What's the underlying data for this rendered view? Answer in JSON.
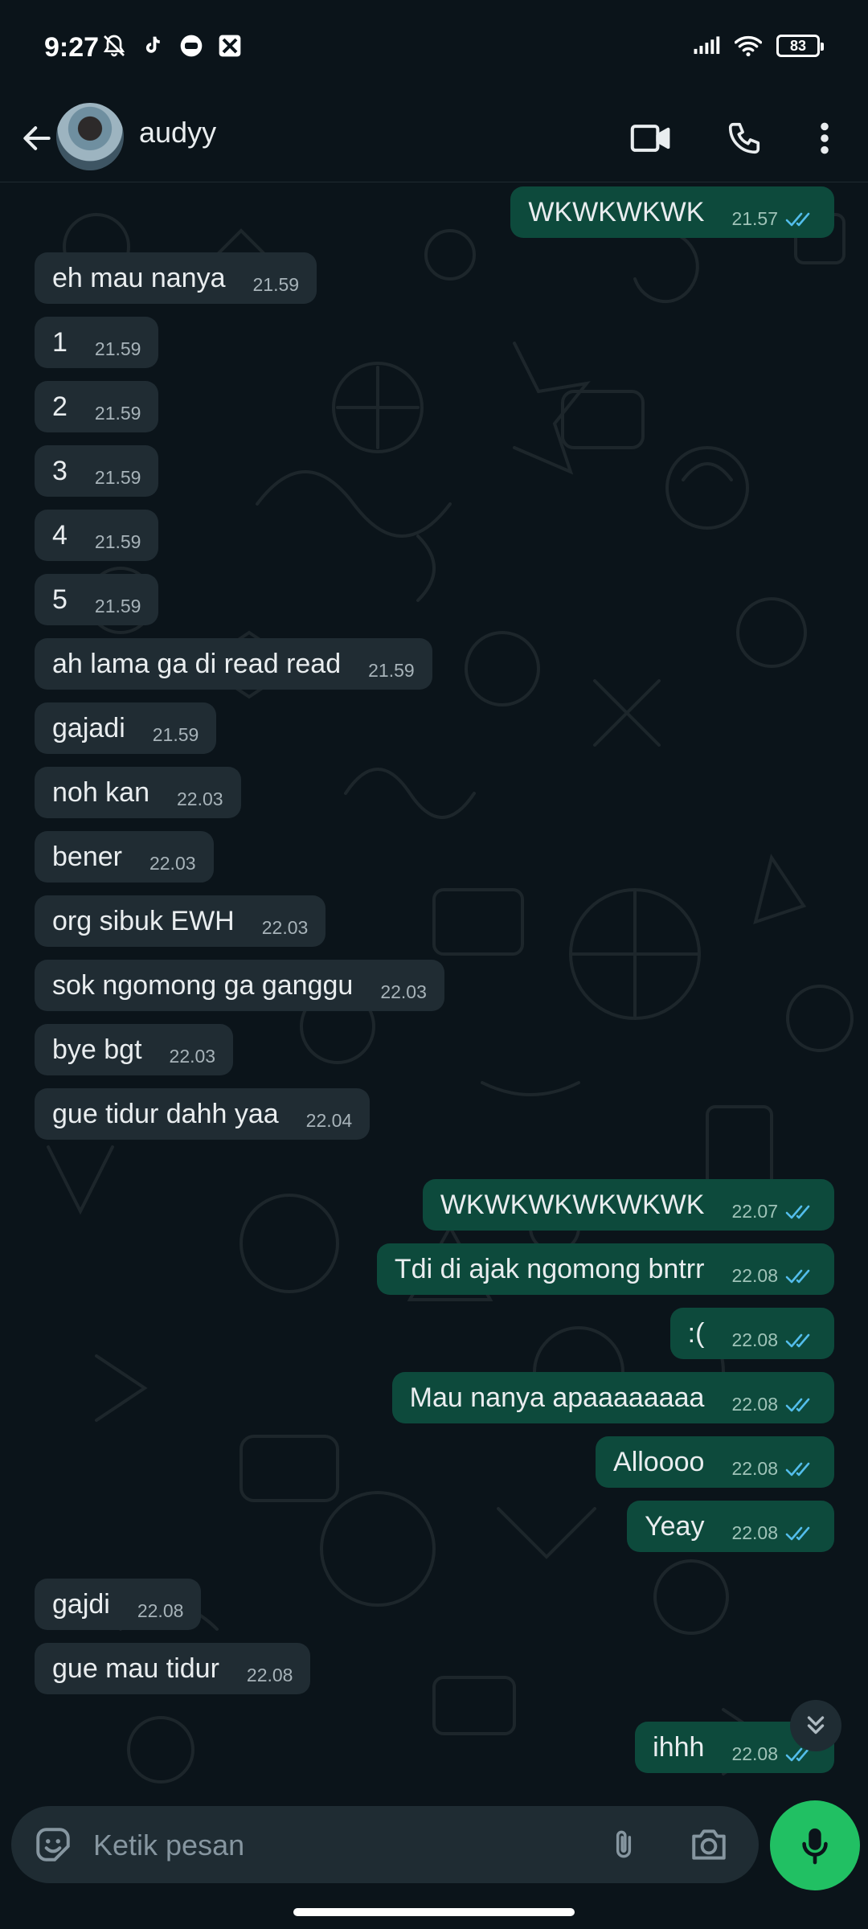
{
  "status_bar": {
    "time": "9:27",
    "battery": "83",
    "icons_left": [
      "bell-off-icon",
      "tiktok-icon",
      "message-icon",
      "app-icon"
    ],
    "icons_right": [
      "signal-icon",
      "wifi-icon",
      "battery-icon"
    ]
  },
  "header": {
    "contact_name": "audyy",
    "icons": [
      "back-arrow-icon",
      "video-call-icon",
      "voice-call-icon",
      "more-options-icon"
    ]
  },
  "messages": [
    {
      "dir": "out",
      "text": "WKWKWKWK",
      "time": "21.57",
      "read": true
    },
    {
      "dir": "in",
      "text": "eh mau nanya",
      "time": "21.59"
    },
    {
      "dir": "in",
      "text": "1",
      "time": "21.59"
    },
    {
      "dir": "in",
      "text": "2",
      "time": "21.59"
    },
    {
      "dir": "in",
      "text": "3",
      "time": "21.59"
    },
    {
      "dir": "in",
      "text": "4",
      "time": "21.59"
    },
    {
      "dir": "in",
      "text": "5",
      "time": "21.59"
    },
    {
      "dir": "in",
      "text": "ah lama ga di read read",
      "time": "21.59"
    },
    {
      "dir": "in",
      "text": "gajadi",
      "time": "21.59"
    },
    {
      "dir": "in",
      "text": "noh kan",
      "time": "22.03"
    },
    {
      "dir": "in",
      "text": "bener",
      "time": "22.03"
    },
    {
      "dir": "in",
      "text": "org sibuk EWH",
      "time": "22.03"
    },
    {
      "dir": "in",
      "text": "sok ngomong ga ganggu",
      "time": "22.03"
    },
    {
      "dir": "in",
      "text": "bye bgt",
      "time": "22.03"
    },
    {
      "dir": "in",
      "text": "gue tidur dahh yaa",
      "time": "22.04"
    },
    {
      "dir": "out",
      "text": "WKWKWKWKWKWK",
      "time": "22.07",
      "read": true
    },
    {
      "dir": "out",
      "text": "Tdi di ajak ngomong bntrr",
      "time": "22.08",
      "read": true
    },
    {
      "dir": "out",
      "text": ":(",
      "time": "22.08",
      "read": true
    },
    {
      "dir": "out",
      "text": "Mau nanya apaaaaaaaa",
      "time": "22.08",
      "read": true
    },
    {
      "dir": "out",
      "text": "Alloooo",
      "time": "22.08",
      "read": true
    },
    {
      "dir": "out",
      "text": "Yeay",
      "time": "22.08",
      "read": true
    },
    {
      "dir": "in",
      "text": "gajdi",
      "time": "22.08"
    },
    {
      "dir": "in",
      "text": "gue mau tidur",
      "time": "22.08"
    },
    {
      "dir": "out",
      "text": "ihhh",
      "time": "22.08",
      "read": true
    }
  ],
  "composer": {
    "placeholder": "Ketik pesan",
    "icons": [
      "emoji-icon",
      "attach-icon",
      "camera-icon",
      "mic-icon"
    ]
  },
  "colors": {
    "background": "#0b141a",
    "incoming_bubble": "#202c33",
    "outgoing_bubble": "#0d4a3c",
    "read_tick": "#53bdeb",
    "mic_button": "#21c063"
  }
}
